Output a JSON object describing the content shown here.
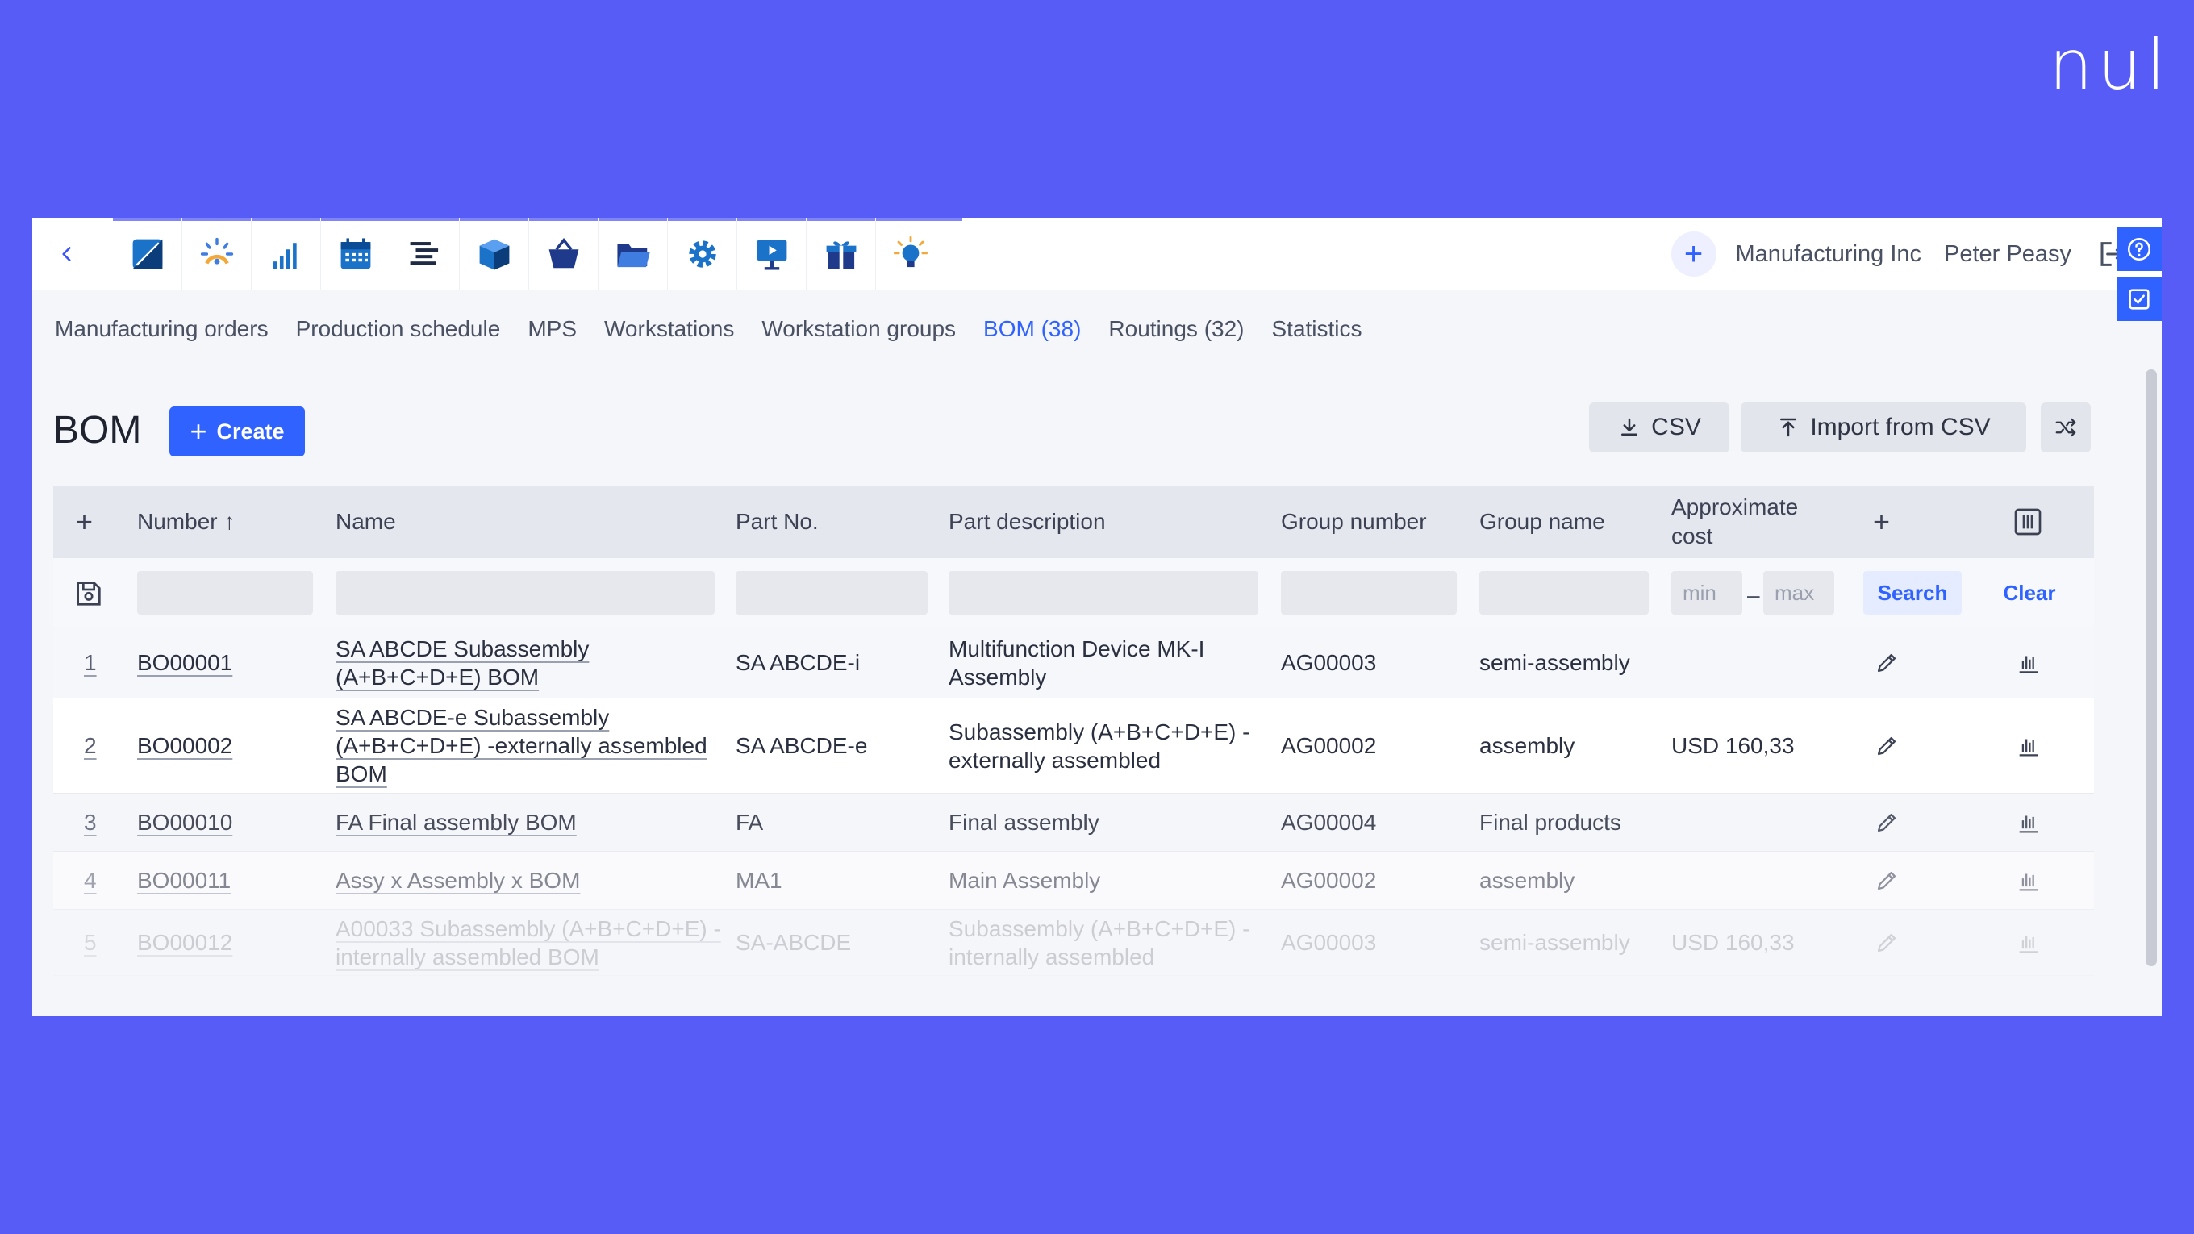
{
  "brand": {
    "text": "nul"
  },
  "modules": [
    {
      "name": "dashboard-icon"
    },
    {
      "name": "progress-icon"
    },
    {
      "name": "signal-icon"
    },
    {
      "name": "calendar-icon"
    },
    {
      "name": "task-list-icon"
    },
    {
      "name": "box-icon"
    },
    {
      "name": "basket-icon"
    },
    {
      "name": "folder-icon"
    },
    {
      "name": "gear-icon"
    },
    {
      "name": "presentation-icon"
    },
    {
      "name": "gift-icon"
    },
    {
      "name": "lightbulb-icon"
    }
  ],
  "topbar": {
    "company": "Manufacturing Inc",
    "user": "Peter Peasy",
    "add_symbol": "+"
  },
  "tabs": [
    {
      "label": "Manufacturing orders",
      "active": false
    },
    {
      "label": "Production schedule",
      "active": false
    },
    {
      "label": "MPS",
      "active": false
    },
    {
      "label": "Workstations",
      "active": false
    },
    {
      "label": "Workstation groups",
      "active": false
    },
    {
      "label": "BOM (38)",
      "active": true
    },
    {
      "label": "Routings (32)",
      "active": false
    },
    {
      "label": "Statistics",
      "active": false
    }
  ],
  "page": {
    "title": "BOM",
    "create_label": "Create",
    "csv_label": "CSV",
    "import_label": "Import from CSV"
  },
  "table": {
    "columns": {
      "add": "+",
      "number": "Number ↑",
      "name": "Name",
      "part_no": "Part No.",
      "part_description": "Part description",
      "group_number": "Group number",
      "group_name": "Group name",
      "approx_cost": "Approximate cost",
      "add_col": "+"
    },
    "filters": {
      "min_placeholder": "min",
      "max_placeholder": "max",
      "dash": "–",
      "search_label": "Search",
      "clear_label": "Clear"
    },
    "rows": [
      {
        "idx": "1",
        "number": "BO00001",
        "name": "SA ABCDE Subassembly (A+B+C+D+E) BOM",
        "part_no": "SA ABCDE-i",
        "part_description": "Multifunction Device MK-I Assembly",
        "group_number": "AG00003",
        "group_name": "semi-assembly",
        "cost": ""
      },
      {
        "idx": "2",
        "number": "BO00002",
        "name": "SA ABCDE-e Subassembly (A+B+C+D+E) -externally assembled BOM",
        "part_no": "SA ABCDE-e",
        "part_description": "Subassembly (A+B+C+D+E) - externally assembled",
        "group_number": "AG00002",
        "group_name": "assembly",
        "cost": "USD 160,33"
      },
      {
        "idx": "3",
        "number": "BO00010",
        "name": "FA Final assembly BOM",
        "part_no": "FA",
        "part_description": "Final assembly",
        "group_number": "AG00004",
        "group_name": "Final products",
        "cost": ""
      },
      {
        "idx": "4",
        "number": "BO00011",
        "name": "Assy x Assembly x BOM",
        "part_no": "MA1",
        "part_description": "Main Assembly",
        "group_number": "AG00002",
        "group_name": "assembly",
        "cost": ""
      },
      {
        "idx": "5",
        "number": "BO00012",
        "name": "A00033 Subassembly (A+B+C+D+E) -internally assembled BOM",
        "part_no": "SA-ABCDE",
        "part_description": "Subassembly (A+B+C+D+E) - internally assembled",
        "group_number": "AG00003",
        "group_name": "semi-assembly",
        "cost": "USD 160,33"
      }
    ]
  },
  "colors": {
    "background": "#585cf6",
    "accent": "#2f62ff",
    "header_row": "#e5e7ee"
  }
}
